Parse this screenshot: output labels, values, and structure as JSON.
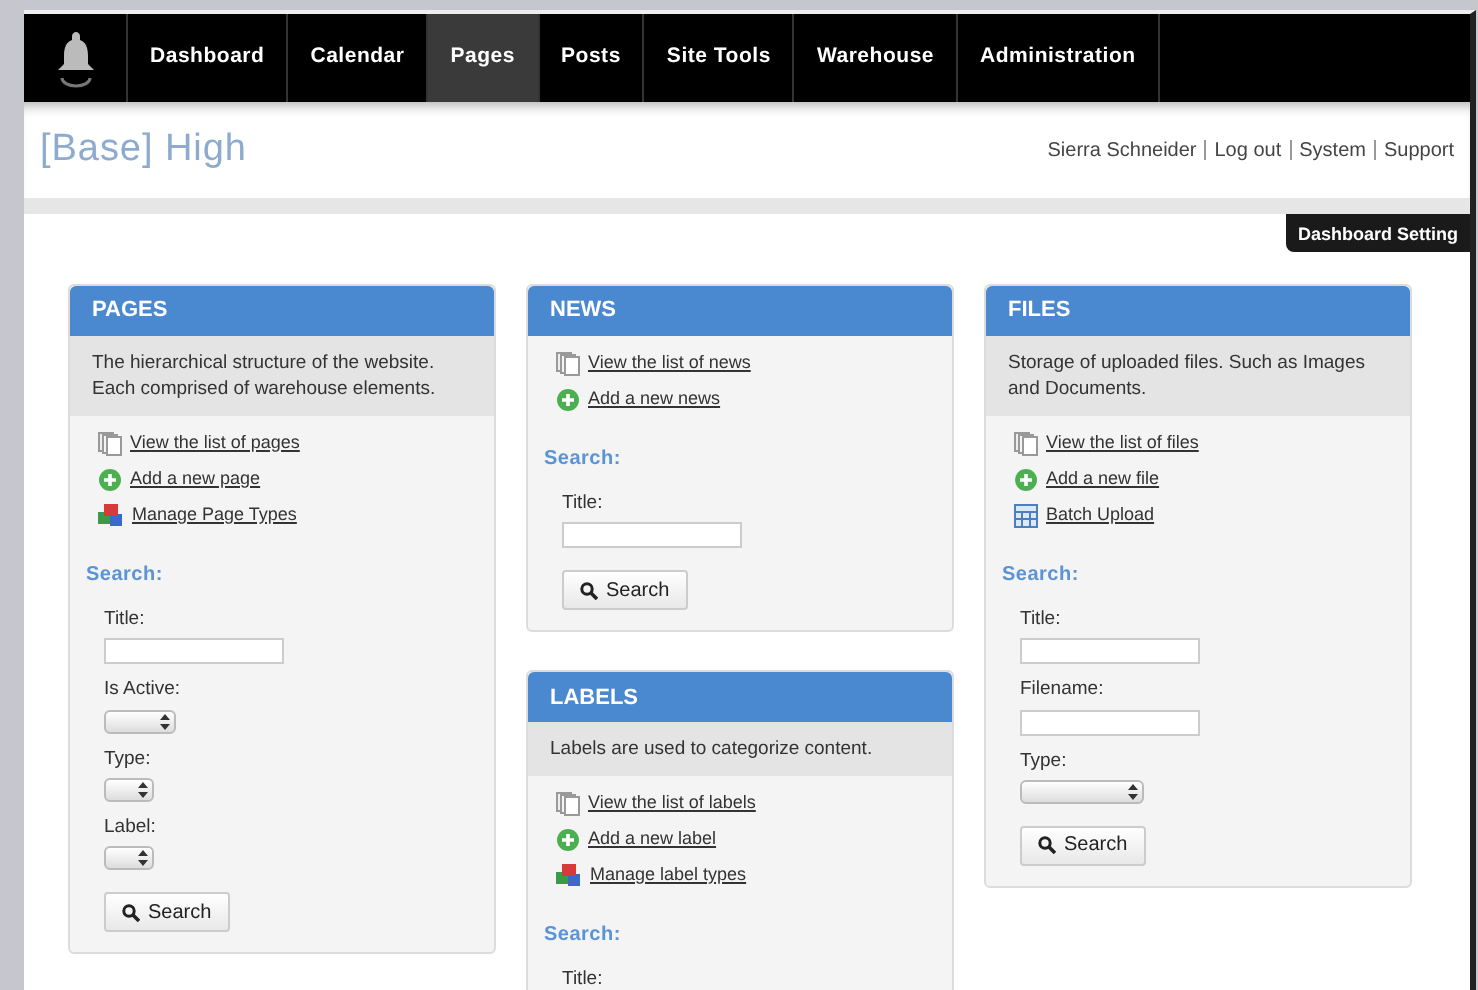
{
  "nav": {
    "items": [
      {
        "label": "Dashboard",
        "selected": false
      },
      {
        "label": "Calendar",
        "selected": false
      },
      {
        "label": "Pages",
        "selected": true
      },
      {
        "label": "Posts",
        "selected": false
      },
      {
        "label": "Site Tools",
        "selected": false
      },
      {
        "label": "Warehouse",
        "selected": false
      },
      {
        "label": "Administration",
        "selected": false
      }
    ]
  },
  "header": {
    "title": "[Base] High",
    "user_links": [
      "Sierra Schneider",
      "Log out",
      "System",
      "Support"
    ]
  },
  "settings_tab": {
    "label": "Dashboard Setting"
  },
  "columns": [
    {
      "panels": [
        {
          "title": "PAGES",
          "description": "The hierarchical structure of the website. Each comprised of warehouse elements.",
          "links": [
            {
              "kind": "list",
              "label": "View the list of pages"
            },
            {
              "kind": "add",
              "label": "Add a new page"
            },
            {
              "kind": "types",
              "label": "Manage Page Types"
            }
          ],
          "search_label": "Search:",
          "fields": [
            {
              "label": "Title:",
              "kind": "text"
            },
            {
              "label": "Is Active:",
              "kind": "select"
            },
            {
              "label": "Type:",
              "kind": "select_small"
            },
            {
              "label": "Label:",
              "kind": "select_small"
            }
          ],
          "button": "Search"
        }
      ]
    },
    {
      "panels": [
        {
          "title": "NEWS",
          "links": [
            {
              "kind": "list",
              "label": "View the list of news"
            },
            {
              "kind": "add",
              "label": "Add a new news"
            }
          ],
          "search_label": "Search:",
          "fields": [
            {
              "label": "Title:",
              "kind": "text"
            }
          ],
          "button": "Search"
        },
        {
          "title": "LABELS",
          "description": "Labels are used to categorize content.",
          "links": [
            {
              "kind": "list",
              "label": "View the list of labels"
            },
            {
              "kind": "add",
              "label": "Add a new label"
            },
            {
              "kind": "types",
              "label": "Manage label types"
            }
          ],
          "search_label": "Search:",
          "fields": [
            {
              "label": "Title:"
            }
          ]
        }
      ]
    },
    {
      "panels": [
        {
          "title": "FILES",
          "description": "Storage of uploaded files. Such as Images and Documents.",
          "links": [
            {
              "kind": "list",
              "label": "View the list of files"
            },
            {
              "kind": "add",
              "label": "Add a new file"
            },
            {
              "kind": "upload",
              "label": "Batch Upload"
            }
          ],
          "search_label": "Search:",
          "fields": [
            {
              "label": "Title:",
              "kind": "text"
            },
            {
              "label": "Filename:",
              "kind": "text"
            },
            {
              "label": "Type:",
              "kind": "select_wide"
            }
          ],
          "button": "Search"
        }
      ]
    }
  ]
}
